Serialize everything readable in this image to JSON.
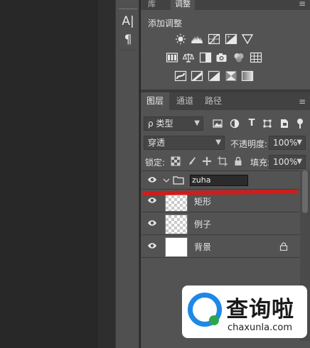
{
  "left_toolbar": {
    "tool1_label": "A|",
    "tool2_label": "¶"
  },
  "adjustments": {
    "tabs": [
      "库",
      "调整"
    ],
    "active_tab": "调整",
    "menu_glyph": "≡",
    "title": "添加调整",
    "rows": [
      [
        "brightness-icon",
        "levels-icon",
        "curves-icon",
        "exposure-icon",
        "vibrance-icon"
      ],
      [
        "hue-saturation-icon",
        "color-balance-icon",
        "black-white-icon",
        "photo-filter-icon",
        "channel-mixer-icon",
        "color-lookup-icon"
      ],
      [
        "invert-icon",
        "posterize-icon",
        "threshold-icon",
        "selective-color-icon",
        "gradient-map-icon"
      ]
    ]
  },
  "layers_panel": {
    "tabs": [
      "图层",
      "通道",
      "路径"
    ],
    "active_tab": "图层",
    "menu_glyph": "≡",
    "filter": {
      "search_glyph": "ρ",
      "value": "类型"
    },
    "filter_icons": [
      "image-filter-icon",
      "adjustment-filter-icon",
      "type-filter-icon",
      "shape-filter-icon",
      "smart-object-filter-icon"
    ],
    "blend_mode": "穿透",
    "opacity_label": "不透明度:",
    "opacity_value": "100%",
    "lock_label": "锁定:",
    "fill_label": "填充:",
    "fill_value": "100%",
    "layers": [
      {
        "name": "zuha",
        "type": "group",
        "editing": true
      },
      {
        "name": "矩形",
        "type": "transparent"
      },
      {
        "name": "例子",
        "type": "transparent"
      },
      {
        "name": "背景",
        "type": "white",
        "locked": true
      }
    ]
  },
  "watermark": {
    "title": "查询啦",
    "url": "chaxunla.com",
    "accent": "#1e88e5",
    "accent2": "#2ea44f"
  },
  "colors": {
    "panel_bg": "#535353",
    "annotation_red": "#d01c1c"
  }
}
